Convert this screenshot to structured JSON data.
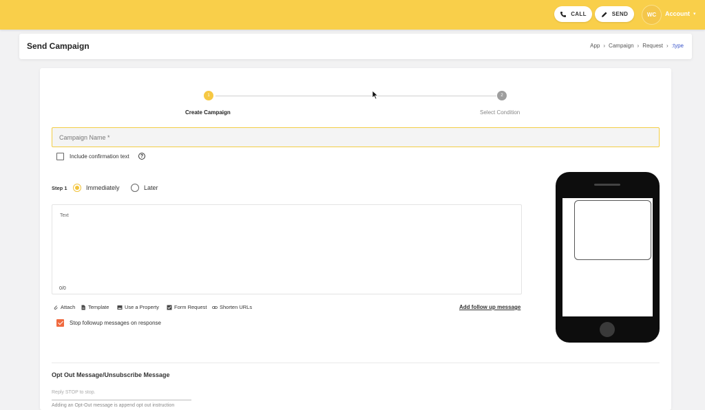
{
  "topbar": {
    "call_label": "CALL",
    "send_label": "SEND",
    "avatar_initials": "WC",
    "account_label": "Account",
    "bg_color": "#f9cf4a"
  },
  "header": {
    "title": "Send Campaign",
    "breadcrumb": [
      "App",
      "Campaign",
      "Request",
      ":type"
    ]
  },
  "stepper": {
    "steps": [
      {
        "number": "1",
        "label": "Create Campaign",
        "active": true
      },
      {
        "number": "2",
        "label": "Select Condition",
        "active": false
      }
    ]
  },
  "form": {
    "campaign_name_placeholder": "Campaign Name *",
    "include_confirmation_label": "Include confirmation text",
    "help_icon_glyph": "?",
    "step_label": "Step 1",
    "schedule_options": [
      {
        "label": "Immediately",
        "selected": true
      },
      {
        "label": "Later",
        "selected": false
      }
    ],
    "text_area": {
      "label": "Text",
      "counter": "0/0"
    },
    "toolbar": [
      {
        "icon": "paperclip-icon",
        "label": "Attach"
      },
      {
        "icon": "document-icon",
        "label": "Template"
      },
      {
        "icon": "image-icon",
        "label": "Use a Property"
      },
      {
        "icon": "checkbox-icon",
        "label": "Form Request"
      },
      {
        "icon": "link-icon",
        "label": "Shorten URLs"
      }
    ],
    "add_followup_label": "Add follow up message",
    "stop_followup_label": "Stop followup messages on response",
    "stop_followup_checked": true
  },
  "optout": {
    "title": "Opt Out Message/Unsubscribe Message",
    "placeholder": "Reply STOP to stop.",
    "hint": "Adding an Opt-Out message is append opt out instruction"
  },
  "colors": {
    "accent": "#f2c33a",
    "checkbox_checked": "#f06a3f",
    "link": "#3a55c9"
  }
}
